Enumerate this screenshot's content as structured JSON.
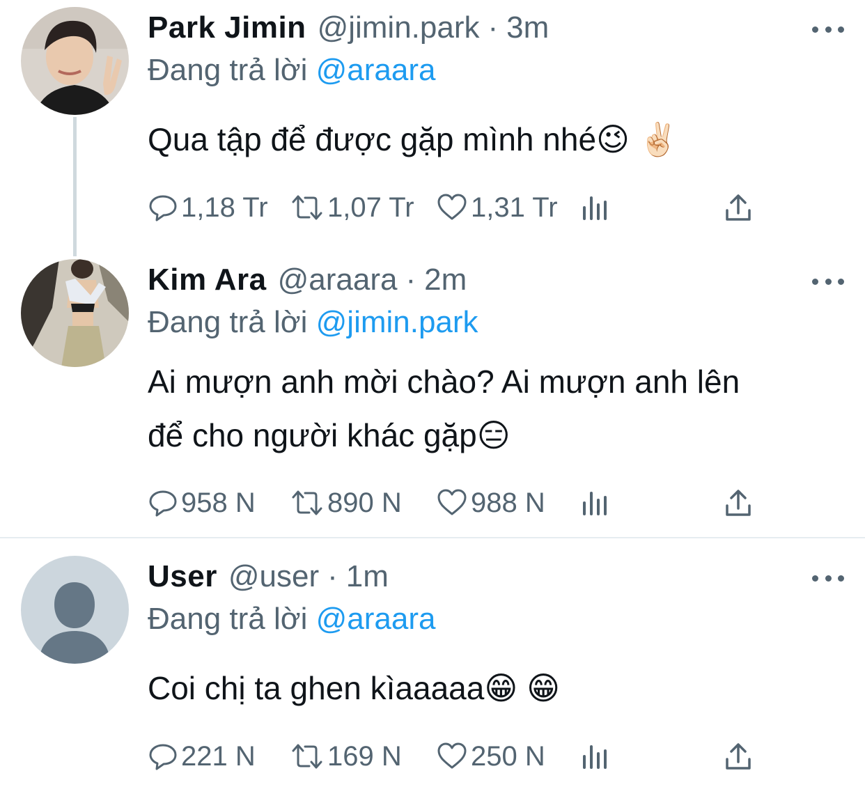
{
  "tweets": [
    {
      "name": "Park Jimin",
      "handle": "@jimin.park",
      "separator": "·",
      "time": "3m",
      "replying_prefix": "Đang trả lời",
      "replying_to": "@araara",
      "text_lines": [
        "Qua tập để được gặp mình nhé😉 ✌🏻"
      ],
      "replies": "1,18 Tr",
      "retweets": "1,07 Tr",
      "likes": "1,31 Tr",
      "avatar_icon": "person-photo-icon"
    },
    {
      "name": "Kim Ara",
      "handle": "@araara",
      "separator": "·",
      "time": "2m",
      "replying_prefix": "Đang trả lời",
      "replying_to": "@jimin.park",
      "text_lines": [
        "Ai mượn anh mời chào? Ai mượn anh lên",
        "để cho người khác gặp😑"
      ],
      "replies": "958 N",
      "retweets": "890 N",
      "likes": "988 N",
      "avatar_icon": "person-photo-icon"
    },
    {
      "name": "User",
      "handle": "@user",
      "separator": "·",
      "time": "1m",
      "replying_prefix": "Đang trả lời",
      "replying_to": "@araara",
      "text_lines": [
        "Coi chị ta ghen kìaaaaa😁 😁"
      ],
      "replies": "221 N",
      "retweets": "169 N",
      "likes": "250 N",
      "avatar_icon": "default-avatar-icon"
    }
  ],
  "colors": {
    "text": "#0f1419",
    "secondary": "#536471",
    "link": "#1d9bf0",
    "divider": "#e6ecf0",
    "thread_line": "#cfd9de"
  }
}
